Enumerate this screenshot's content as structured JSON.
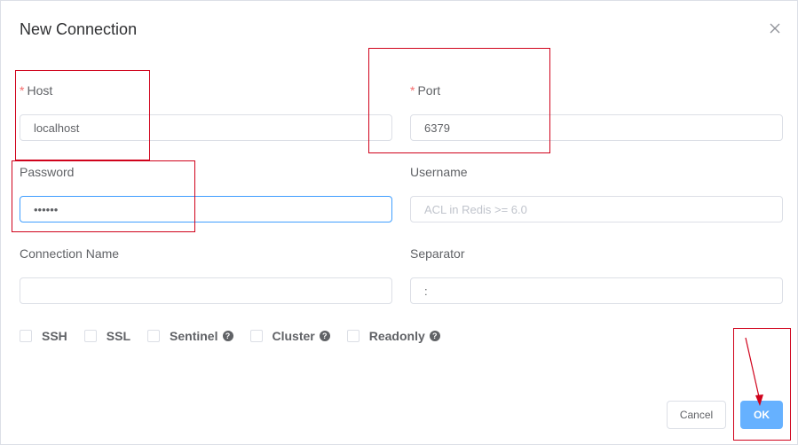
{
  "dialog": {
    "title": "New Connection"
  },
  "form": {
    "host": {
      "label": "Host",
      "required_mark": "*",
      "value": "localhost"
    },
    "port": {
      "label": "Port",
      "required_mark": "*",
      "value": "6379"
    },
    "password": {
      "label": "Password",
      "value": "••••••"
    },
    "username": {
      "label": "Username",
      "value": "",
      "placeholder": "ACL in Redis >= 6.0"
    },
    "connection_name": {
      "label": "Connection Name",
      "value": ""
    },
    "separator": {
      "label": "Separator",
      "value": ":"
    }
  },
  "options": {
    "ssh": "SSH",
    "ssl": "SSL",
    "sentinel": "Sentinel",
    "cluster": "Cluster",
    "readonly": "Readonly",
    "help_glyph": "?"
  },
  "buttons": {
    "cancel": "Cancel",
    "ok": "OK"
  },
  "annotation_color": "#d0021b",
  "icons": [
    "close-icon",
    "help-icon",
    "checkbox-icon"
  ]
}
